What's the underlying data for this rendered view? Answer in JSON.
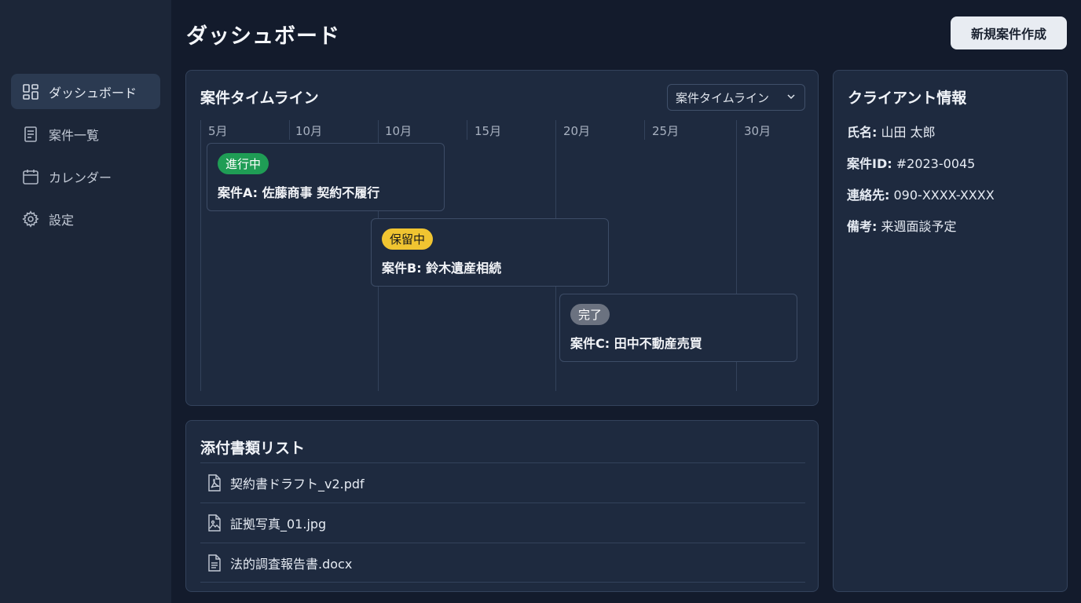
{
  "page": {
    "title": "ダッシュボード",
    "new_case_button": "新規案件作成"
  },
  "sidebar": {
    "items": [
      {
        "label": "ダッシュボード",
        "icon": "dashboard-icon",
        "active": true
      },
      {
        "label": "案件一覧",
        "icon": "list-icon",
        "active": false
      },
      {
        "label": "カレンダー",
        "icon": "calendar-icon",
        "active": false
      },
      {
        "label": "設定",
        "icon": "gear-icon",
        "active": false
      }
    ]
  },
  "timeline": {
    "title": "案件タイムライン",
    "select_value": "案件タイムライン",
    "axis_labels": [
      "5月",
      "10月",
      "10月",
      "15月",
      "20月",
      "25月",
      "30月"
    ],
    "cases": [
      {
        "status": "進行中",
        "status_color": "#1f9d55",
        "name": "案件A: 佐藤商事 契約不履行"
      },
      {
        "status": "保留中",
        "status_color": "#f0c431",
        "name": "案件B: 鈴木遺産相続"
      },
      {
        "status": "完了",
        "status_color": "#6b7280",
        "name": "案件C: 田中不動産売買"
      }
    ]
  },
  "documents": {
    "title": "添付書類リスト",
    "items": [
      {
        "name": "契約書ドラフト_v2.pdf",
        "icon": "pdf-file-icon"
      },
      {
        "name": "証拠写真_01.jpg",
        "icon": "image-file-icon"
      },
      {
        "name": "法的調査報告書.docx",
        "icon": "document-file-icon"
      }
    ]
  },
  "client": {
    "title": "クライアント情報",
    "fields": [
      {
        "key": "氏名:",
        "value": "山田 太郎"
      },
      {
        "key": "案件ID:",
        "value": "#2023-0045"
      },
      {
        "key": "連絡先:",
        "value": "090-XXXX-XXXX"
      },
      {
        "key": "備考:",
        "value": "来週面談予定"
      }
    ]
  }
}
